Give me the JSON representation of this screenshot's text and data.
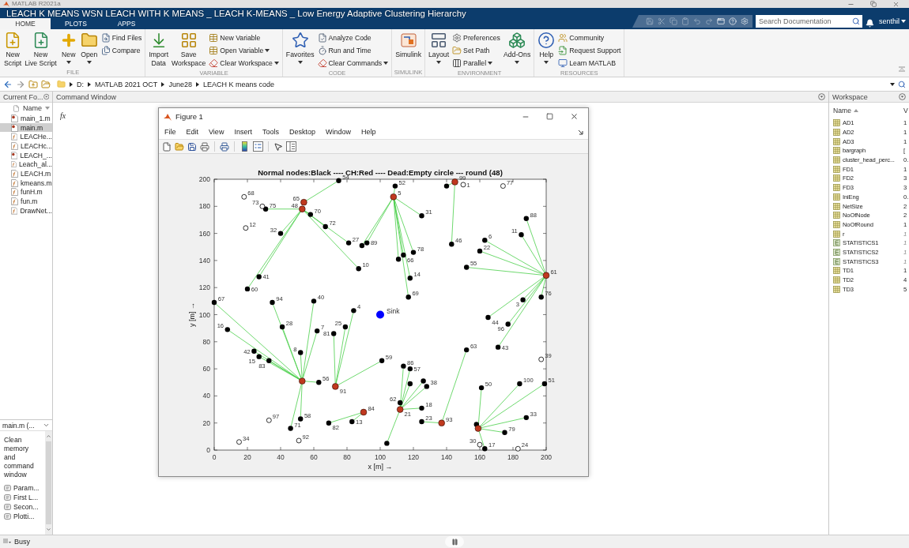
{
  "window": {
    "title": "MATLAB R2021a"
  },
  "video": {
    "title": "LEACH K MEANS WSN LEACH WITH K MEANS _ LEACH K-MEANS _ Low Energy Adaptive Clustering Hierarchy"
  },
  "tabs": [
    {
      "label": "HOME",
      "selected": true
    },
    {
      "label": "PLOTS",
      "selected": false
    },
    {
      "label": "APPS",
      "selected": false
    }
  ],
  "search": {
    "placeholder": "Search Documentation"
  },
  "user": {
    "name": "senthil"
  },
  "toolstrip": {
    "sections": [
      {
        "label": "FILE",
        "columns": [
          {
            "kind": "large",
            "label": "New\nScript",
            "menu": false
          },
          {
            "kind": "large",
            "label": "New\nLive Script",
            "menu": false
          },
          {
            "kind": "large",
            "label": "New",
            "menu": true
          },
          {
            "kind": "large",
            "label": "Open",
            "menu": true
          },
          {
            "kind": "stack",
            "buttons": [
              {
                "label": "Find Files",
                "menu": false
              },
              {
                "label": "Compare",
                "menu": false
              }
            ]
          }
        ]
      },
      {
        "label": "VARIABLE",
        "columns": [
          {
            "kind": "large",
            "label": "Import\nData",
            "menu": false
          },
          {
            "kind": "large",
            "label": "Save\nWorkspace",
            "menu": false
          },
          {
            "kind": "stack",
            "buttons": [
              {
                "label": "New Variable",
                "menu": false
              },
              {
                "label": "Open Variable",
                "menu": true
              },
              {
                "label": "Clear Workspace",
                "menu": true
              }
            ]
          }
        ]
      },
      {
        "label": "CODE",
        "columns": [
          {
            "kind": "large",
            "label": "Favorites",
            "menu": true
          },
          {
            "kind": "stack",
            "buttons": [
              {
                "label": "Analyze Code",
                "menu": false
              },
              {
                "label": "Run and Time",
                "menu": false
              },
              {
                "label": "Clear Commands",
                "menu": true
              }
            ]
          }
        ]
      },
      {
        "label": "SIMULINK",
        "columns": [
          {
            "kind": "large",
            "label": "Simulink",
            "menu": false
          }
        ]
      },
      {
        "label": "ENVIRONMENT",
        "columns": [
          {
            "kind": "large",
            "label": "Layout",
            "menu": true
          },
          {
            "kind": "stack",
            "buttons": [
              {
                "label": "Preferences",
                "menu": false
              },
              {
                "label": "Set Path",
                "menu": false
              },
              {
                "label": "Parallel",
                "menu": true
              }
            ]
          },
          {
            "kind": "large",
            "label": "Add-Ons",
            "menu": true
          }
        ]
      },
      {
        "label": "RESOURCES",
        "columns": [
          {
            "kind": "large",
            "label": "Help",
            "menu": true
          },
          {
            "kind": "stack",
            "buttons": [
              {
                "label": "Community",
                "menu": false
              },
              {
                "label": "Request Support",
                "menu": false
              },
              {
                "label": "Learn MATLAB",
                "menu": false
              }
            ]
          }
        ]
      }
    ]
  },
  "address_bar": {
    "path": [
      "D:",
      "MATLAB 2021 OCT",
      "June28",
      "LEACH K means code"
    ]
  },
  "current_folder": {
    "title": "Current Fo...",
    "column": "Name",
    "files": [
      {
        "name": "main_1.m",
        "kind": "script",
        "selected": false
      },
      {
        "name": "main.m",
        "kind": "script",
        "selected": true
      },
      {
        "name": "LEACHe...",
        "kind": "function",
        "selected": false
      },
      {
        "name": "LEACHc...",
        "kind": "function",
        "selected": false
      },
      {
        "name": "LEACH_...",
        "kind": "script",
        "selected": false
      },
      {
        "name": "Leach_al...",
        "kind": "function",
        "selected": false
      },
      {
        "name": "LEACH.m",
        "kind": "function",
        "selected": false
      },
      {
        "name": "kmeans.m",
        "kind": "function",
        "selected": false
      },
      {
        "name": "funH.m",
        "kind": "function",
        "selected": false
      },
      {
        "name": "fun.m",
        "kind": "function",
        "selected": false
      },
      {
        "name": "DrawNet...",
        "kind": "function",
        "selected": false
      }
    ],
    "details": {
      "title": "main.m (...",
      "description": "Clean memory and command window",
      "sections": [
        "Param...",
        "First L...",
        "Secon...",
        "Plotti..."
      ]
    }
  },
  "command_window": {
    "title": "Command Window",
    "prompt": "fx"
  },
  "figure": {
    "title": "Figure 1",
    "menu": [
      "File",
      "Edit",
      "View",
      "Insert",
      "Tools",
      "Desktop",
      "Window",
      "Help"
    ],
    "chart_data": {
      "type": "scatter",
      "title": "Normal nodes:Black ---- CH:Red ---- Dead:Empty circle --- round (48)",
      "xlabel": "x [m] →",
      "ylabel": "y [m] →",
      "xlim": [
        0,
        200
      ],
      "ylim": [
        0,
        200
      ],
      "xticks": [
        0,
        20,
        40,
        60,
        80,
        100,
        120,
        140,
        160,
        180,
        200
      ],
      "yticks": [
        0,
        20,
        40,
        60,
        80,
        100,
        120,
        140,
        160,
        180,
        200
      ],
      "series": [
        {
          "color": "#000000",
          "x": [
            31,
            58,
            40,
            67,
            75,
            81,
            89,
            92,
            87,
            27,
            20,
            0,
            35,
            60,
            84,
            8,
            41,
            62,
            72,
            79,
            109,
            125,
            114,
            111,
            120,
            118,
            117,
            140,
            188,
            185,
            163,
            143,
            160,
            152,
            186,
            197,
            165,
            177,
            24,
            27,
            33,
            52,
            101,
            114,
            118,
            152,
            171,
            63,
            161,
            184,
            199,
            128,
            126,
            118,
            112,
            125,
            83,
            69,
            52,
            46,
            125,
            188,
            175,
            163,
            158,
            104
          ],
          "values": [
            178,
            174,
            160,
            165,
            199,
            153,
            151,
            153,
            134,
            128,
            119,
            109,
            109,
            110,
            103,
            89,
            91,
            88,
            86,
            91,
            195,
            173,
            144,
            141,
            146,
            127,
            113,
            195,
            171,
            159,
            155,
            152,
            147,
            135,
            111,
            113,
            98,
            93,
            73,
            69,
            66,
            72,
            66,
            62,
            60,
            74,
            76,
            50,
            46,
            49,
            49,
            47,
            51,
            49,
            35,
            31,
            21,
            20,
            23,
            16,
            21,
            24,
            13,
            1,
            19,
            5
          ]
        },
        {
          "color": "#c0391f",
          "x": [
            54,
            53,
            108,
            145,
            200,
            53,
            73,
            112,
            90,
            137,
            159
          ],
          "values": [
            183,
            178,
            187,
            198,
            129,
            51,
            47,
            30,
            28,
            20,
            16
          ]
        },
        {
          "color": "#000000",
          "x": [
            18,
            29,
            19,
            150,
            174,
            197,
            33,
            51,
            160,
            183,
            15
          ],
          "values": [
            187,
            180,
            164,
            196,
            195,
            67,
            22,
            7,
            4,
            1,
            6
          ]
        },
        {
          "color": "#0000ff",
          "x": [
            100
          ],
          "values": [
            100
          ]
        }
      ],
      "annotations": [
        {
          "x": 31,
          "y": 178,
          "text": "75"
        },
        {
          "x": 58,
          "y": 174,
          "text": "70"
        },
        {
          "x": 40,
          "y": 160,
          "text": "32"
        },
        {
          "x": 67,
          "y": 165,
          "text": "72"
        },
        {
          "x": 75,
          "y": 199,
          "text": "54"
        },
        {
          "x": 81,
          "y": 153,
          "text": "27"
        },
        {
          "x": 92,
          "y": 153,
          "text": "89"
        },
        {
          "x": 87,
          "y": 134,
          "text": "10"
        },
        {
          "x": 27,
          "y": 128,
          "text": "41"
        },
        {
          "x": 20,
          "y": 119,
          "text": "60"
        },
        {
          "x": 0,
          "y": 109,
          "text": "67"
        },
        {
          "x": 35,
          "y": 109,
          "text": "94"
        },
        {
          "x": 60,
          "y": 110,
          "text": "40"
        },
        {
          "x": 84,
          "y": 103,
          "text": "4"
        },
        {
          "x": 8,
          "y": 89,
          "text": "16"
        },
        {
          "x": 41,
          "y": 91,
          "text": "28"
        },
        {
          "x": 62,
          "y": 88,
          "text": "7"
        },
        {
          "x": 72,
          "y": 86,
          "text": "81"
        },
        {
          "x": 79,
          "y": 91,
          "text": "25"
        },
        {
          "x": 109,
          "y": 195,
          "text": "52"
        },
        {
          "x": 125,
          "y": 173,
          "text": "31"
        },
        {
          "x": 114,
          "y": 144,
          "text": "66"
        },
        {
          "x": 120,
          "y": 146,
          "text": "78"
        },
        {
          "x": 118,
          "y": 127,
          "text": "14"
        },
        {
          "x": 117,
          "y": 113,
          "text": "69"
        },
        {
          "x": 188,
          "y": 171,
          "text": "88"
        },
        {
          "x": 185,
          "y": 159,
          "text": "11"
        },
        {
          "x": 163,
          "y": 155,
          "text": "6"
        },
        {
          "x": 143,
          "y": 152,
          "text": "46"
        },
        {
          "x": 160,
          "y": 147,
          "text": "22"
        },
        {
          "x": 152,
          "y": 135,
          "text": "55"
        },
        {
          "x": 186,
          "y": 111,
          "text": "3"
        },
        {
          "x": 197,
          "y": 113,
          "text": "76"
        },
        {
          "x": 165,
          "y": 98,
          "text": "44"
        },
        {
          "x": 177,
          "y": 93,
          "text": "96"
        },
        {
          "x": 24,
          "y": 73,
          "text": "42"
        },
        {
          "x": 27,
          "y": 69,
          "text": "15"
        },
        {
          "x": 33,
          "y": 66,
          "text": "83"
        },
        {
          "x": 52,
          "y": 72,
          "text": "8"
        },
        {
          "x": 101,
          "y": 66,
          "text": "59"
        },
        {
          "x": 114,
          "y": 62,
          "text": "86"
        },
        {
          "x": 118,
          "y": 60,
          "text": "57"
        },
        {
          "x": 152,
          "y": 74,
          "text": "63"
        },
        {
          "x": 171,
          "y": 76,
          "text": "43"
        },
        {
          "x": 63,
          "y": 50,
          "text": "56"
        },
        {
          "x": 161,
          "y": 46,
          "text": "50"
        },
        {
          "x": 184,
          "y": 49,
          "text": "100"
        },
        {
          "x": 199,
          "y": 49,
          "text": "51"
        },
        {
          "x": 128,
          "y": 47,
          "text": "38"
        },
        {
          "x": 112,
          "y": 35,
          "text": "62"
        },
        {
          "x": 125,
          "y": 31,
          "text": "18"
        },
        {
          "x": 83,
          "y": 21,
          "text": "13"
        },
        {
          "x": 69,
          "y": 20,
          "text": "82"
        },
        {
          "x": 52,
          "y": 23,
          "text": "58"
        },
        {
          "x": 46,
          "y": 16,
          "text": "71"
        },
        {
          "x": 125,
          "y": 21,
          "text": "23"
        },
        {
          "x": 188,
          "y": 24,
          "text": "33"
        },
        {
          "x": 175,
          "y": 13,
          "text": "79"
        },
        {
          "x": 163,
          "y": 1,
          "text": "17"
        },
        {
          "x": 54,
          "y": 183,
          "text": "65"
        },
        {
          "x": 53,
          "y": 178,
          "text": "48"
        },
        {
          "x": 108,
          "y": 187,
          "text": "5"
        },
        {
          "x": 145,
          "y": 198,
          "text": "99"
        },
        {
          "x": 200,
          "y": 129,
          "text": "61"
        },
        {
          "x": 73,
          "y": 47,
          "text": "91"
        },
        {
          "x": 112,
          "y": 30,
          "text": "21"
        },
        {
          "x": 90,
          "y": 28,
          "text": "84"
        },
        {
          "x": 137,
          "y": 20,
          "text": "93"
        },
        {
          "x": 18,
          "y": 187,
          "text": "68"
        },
        {
          "x": 29,
          "y": 180,
          "text": "73"
        },
        {
          "x": 19,
          "y": 164,
          "text": "12"
        },
        {
          "x": 150,
          "y": 196,
          "text": "1"
        },
        {
          "x": 174,
          "y": 195,
          "text": "77"
        },
        {
          "x": 197,
          "y": 67,
          "text": "39"
        },
        {
          "x": 33,
          "y": 22,
          "text": "97"
        },
        {
          "x": 51,
          "y": 7,
          "text": "92"
        },
        {
          "x": 160,
          "y": 4,
          "text": "30"
        },
        {
          "x": 183,
          "y": 1,
          "text": "24"
        },
        {
          "x": 15,
          "y": 6,
          "text": "34"
        },
        {
          "x": 100,
          "y": 100,
          "text": "Sink"
        }
      ]
    }
  },
  "workspace": {
    "title": "Workspace",
    "columns": [
      "Name",
      "V"
    ],
    "variables": [
      {
        "name": "AD1",
        "value": "1",
        "kind": "matrix",
        "dimmed": false
      },
      {
        "name": "AD2",
        "value": "1",
        "kind": "matrix",
        "dimmed": false
      },
      {
        "name": "AD3",
        "value": "1",
        "kind": "matrix",
        "dimmed": false
      },
      {
        "name": "bargraph",
        "value": "[",
        "kind": "matrix",
        "dimmed": false
      },
      {
        "name": "cluster_head_perc...",
        "value": "0.",
        "kind": "matrix",
        "dimmed": false
      },
      {
        "name": "FD1",
        "value": "1",
        "kind": "matrix",
        "dimmed": false
      },
      {
        "name": "FD2",
        "value": "3",
        "kind": "matrix",
        "dimmed": false
      },
      {
        "name": "FD3",
        "value": "3",
        "kind": "matrix",
        "dimmed": false
      },
      {
        "name": "IniEng",
        "value": "0.",
        "kind": "matrix",
        "dimmed": false
      },
      {
        "name": "NetSize",
        "value": "2",
        "kind": "matrix",
        "dimmed": false
      },
      {
        "name": "NoOfNode",
        "value": "2",
        "kind": "matrix",
        "dimmed": false
      },
      {
        "name": "NoOfRound",
        "value": "1",
        "kind": "matrix",
        "dimmed": false
      },
      {
        "name": "r",
        "value": "1",
        "kind": "matrix",
        "dimmed": true
      },
      {
        "name": "STATISTICS1",
        "value": "1",
        "kind": "struct",
        "dimmed": true
      },
      {
        "name": "STATISTICS2",
        "value": "1",
        "kind": "struct",
        "dimmed": true
      },
      {
        "name": "STATISTICS3",
        "value": "1",
        "kind": "struct",
        "dimmed": true
      },
      {
        "name": "TD1",
        "value": "1",
        "kind": "matrix",
        "dimmed": false
      },
      {
        "name": "TD2",
        "value": "4",
        "kind": "matrix",
        "dimmed": false
      },
      {
        "name": "TD3",
        "value": "5",
        "kind": "matrix",
        "dimmed": false
      }
    ]
  },
  "status_bar": {
    "text": "Busy"
  }
}
